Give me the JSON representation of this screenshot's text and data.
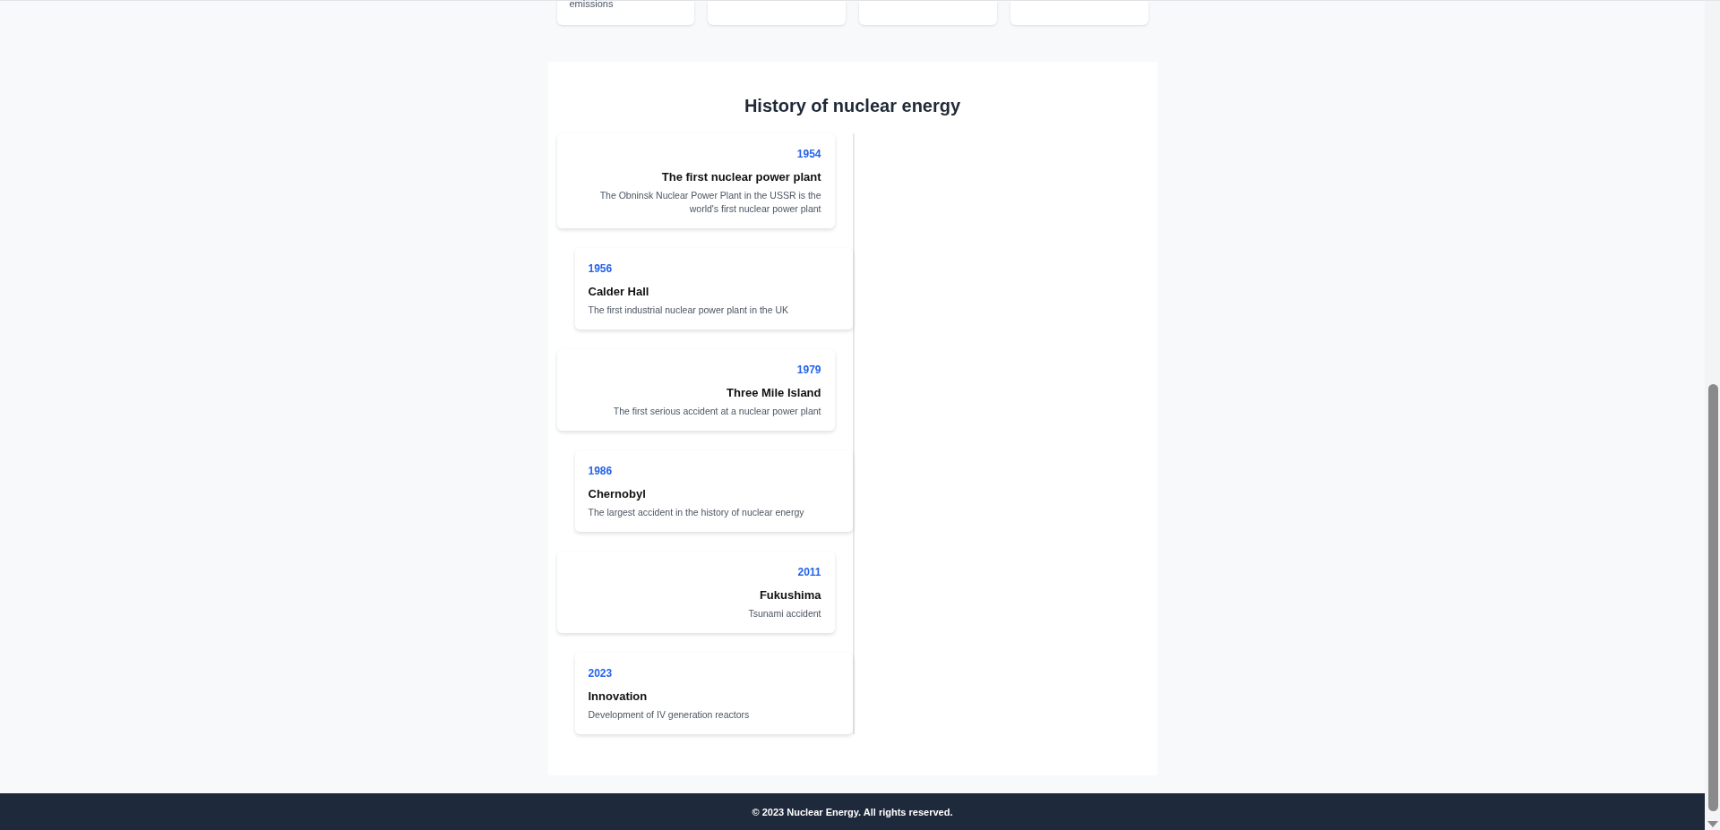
{
  "top_cards": [
    {
      "kind": "text",
      "text": "emissions"
    },
    {
      "kind": "empty"
    },
    {
      "kind": "empty"
    },
    {
      "kind": "empty"
    }
  ],
  "history": {
    "title": "History of nuclear energy",
    "events": [
      {
        "kind": "left",
        "year": "1954",
        "title": "The first nuclear power plant",
        "description": "The Obninsk Nuclear Power Plant in the USSR is the world's first nuclear power plant"
      },
      {
        "kind": "right",
        "year": "1956",
        "title": "Calder Hall",
        "description": "The first industrial nuclear power plant in the UK"
      },
      {
        "kind": "left",
        "year": "1979",
        "title": "Three Mile Island",
        "description": "The first serious accident at a nuclear power plant"
      },
      {
        "kind": "right",
        "year": "1986",
        "title": "Chernobyl",
        "description": "The largest accident in the history of nuclear energy"
      },
      {
        "kind": "left",
        "year": "2011",
        "title": "Fukushima",
        "description": "Tsunami accident"
      },
      {
        "kind": "right",
        "year": "2023",
        "title": "Innovation",
        "description": "Development of IV generation reactors"
      }
    ]
  },
  "footer": {
    "text": "© 2023 Nuclear Energy. All rights reserved."
  }
}
